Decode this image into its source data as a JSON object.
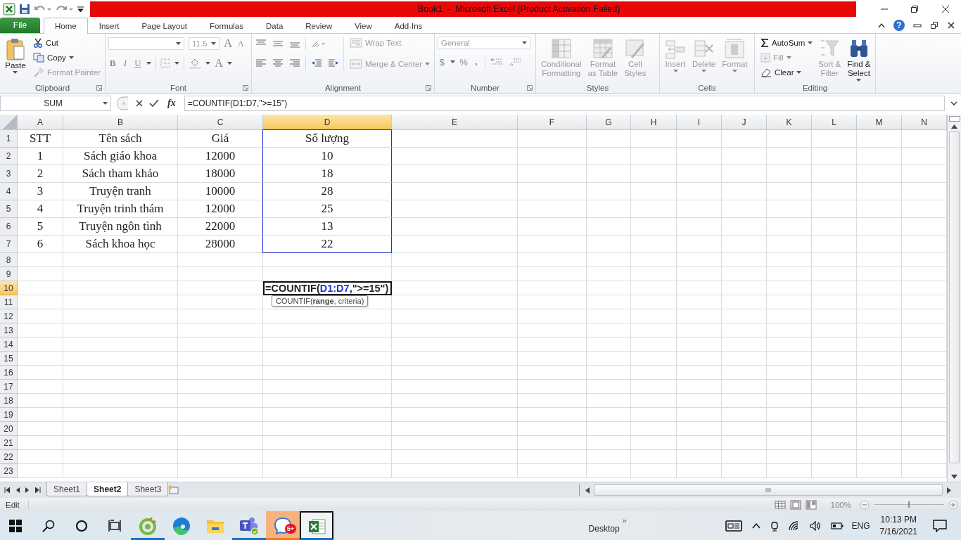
{
  "window": {
    "title": "Book1  -  Microsoft Excel (Product Activation Failed)"
  },
  "tabs": [
    {
      "label": "File",
      "kind": "file",
      "selected": false
    },
    {
      "label": "Home",
      "kind": "tab",
      "selected": true
    },
    {
      "label": "Insert",
      "kind": "tab",
      "selected": false
    },
    {
      "label": "Page Layout",
      "kind": "tab",
      "selected": false
    },
    {
      "label": "Formulas",
      "kind": "tab",
      "selected": false
    },
    {
      "label": "Data",
      "kind": "tab",
      "selected": false
    },
    {
      "label": "Review",
      "kind": "tab",
      "selected": false
    },
    {
      "label": "View",
      "kind": "tab",
      "selected": false
    },
    {
      "label": "Add-Ins",
      "kind": "tab",
      "selected": false
    }
  ],
  "help": "?",
  "ribbon": {
    "clipboard": {
      "title": "Clipboard",
      "paste": {
        "label": "Paste",
        "disabled": false
      },
      "cut": {
        "label": "Cut",
        "disabled": false
      },
      "copy": {
        "label": "Copy",
        "disabled": false
      },
      "format_painter": {
        "label": "Format Painter",
        "disabled": true
      }
    },
    "font": {
      "title": "Font",
      "size": "11.5",
      "grow": "A",
      "shrink": "A",
      "bold": "B",
      "italic": "I",
      "underline": "U",
      "font_color": "A"
    },
    "alignment": {
      "title": "Alignment",
      "wrap_text": {
        "label": "Wrap Text",
        "disabled": true
      },
      "merge_center": {
        "label": "Merge & Center",
        "disabled": true
      }
    },
    "number": {
      "title": "Number",
      "format": "General",
      "currency": "$",
      "percent": "%",
      "comma": ","
    },
    "styles": {
      "title": "Styles",
      "buttons": [
        {
          "label": "Conditional\nFormatting",
          "kind": "conditional",
          "disabled": true
        },
        {
          "label": "Format\nas Table",
          "kind": "table",
          "disabled": true
        },
        {
          "label": "Cell\nStyles",
          "kind": "cell-styles",
          "disabled": true
        }
      ]
    },
    "cells": {
      "title": "Cells",
      "buttons": [
        {
          "label": "Insert",
          "kind": "insert",
          "disabled": true
        },
        {
          "label": "Delete",
          "kind": "delete",
          "disabled": true
        },
        {
          "label": "Format",
          "kind": "format",
          "disabled": true
        }
      ]
    },
    "editing": {
      "title": "Editing",
      "autosum": {
        "label": "AutoSum",
        "disabled": false
      },
      "fill": {
        "label": "Fill",
        "disabled": true
      },
      "clear": {
        "label": "Clear",
        "disabled": false
      },
      "sort_filter": {
        "label": "Sort &\nFilter",
        "disabled": true
      },
      "find_select": {
        "label": "Find &\nSelect",
        "disabled": false
      }
    }
  },
  "formula_bar": {
    "name_box": "SUM",
    "function_label": "fx",
    "formula": "=COUNTIF(D1:D7,\">=15\")"
  },
  "columns": [
    {
      "label": "A",
      "selected": false
    },
    {
      "label": "B",
      "selected": false
    },
    {
      "label": "C",
      "selected": false
    },
    {
      "label": "D",
      "selected": true
    },
    {
      "label": "E",
      "selected": false
    },
    {
      "label": "F",
      "selected": false
    },
    {
      "label": "G",
      "selected": false
    },
    {
      "label": "H",
      "selected": false
    },
    {
      "label": "I",
      "selected": false
    },
    {
      "label": "J",
      "selected": false
    },
    {
      "label": "K",
      "selected": false
    },
    {
      "label": "L",
      "selected": false
    },
    {
      "label": "M",
      "selected": false
    },
    {
      "label": "N",
      "selected": false
    }
  ],
  "rows": [
    {
      "number": "1",
      "selected": false,
      "in_reference": true,
      "cells": [
        "STT",
        "Tên sách",
        "Giá",
        "Số lượng"
      ]
    },
    {
      "number": "2",
      "selected": false,
      "in_reference": true,
      "cells": [
        "1",
        "Sách giáo khoa",
        "12000",
        "10"
      ]
    },
    {
      "number": "3",
      "selected": false,
      "in_reference": true,
      "cells": [
        "2",
        "Sách tham khảo",
        "18000",
        "18"
      ]
    },
    {
      "number": "4",
      "selected": false,
      "in_reference": true,
      "cells": [
        "3",
        "Truyện tranh",
        "10000",
        "28"
      ]
    },
    {
      "number": "5",
      "selected": false,
      "in_reference": true,
      "cells": [
        "4",
        "Truyện trinh thám",
        "12000",
        "25"
      ]
    },
    {
      "number": "6",
      "selected": false,
      "in_reference": true,
      "cells": [
        "5",
        "Truyện ngôn tình",
        "22000",
        "13"
      ]
    },
    {
      "number": "7",
      "selected": false,
      "in_reference": true,
      "cells": [
        "6",
        "Sách khoa học",
        "28000",
        "22"
      ]
    },
    {
      "number": "8",
      "selected": false,
      "in_reference": false
    },
    {
      "number": "9",
      "selected": false,
      "in_reference": false
    },
    {
      "number": "10",
      "selected": true,
      "in_reference": false,
      "editing": {
        "segments": [
          {
            "text": "=COUNTIF(",
            "kind": "text"
          },
          {
            "text": "D1:D7",
            "kind": "reference"
          },
          {
            "text": ",\">=15\")",
            "kind": "text"
          }
        ],
        "tooltip": "COUNTIF(**range**, criteria)"
      }
    },
    {
      "number": "11",
      "selected": false,
      "in_reference": false
    },
    {
      "number": "12",
      "selected": false,
      "in_reference": false
    },
    {
      "number": "13",
      "selected": false,
      "in_reference": false
    },
    {
      "number": "14",
      "selected": false,
      "in_reference": false
    },
    {
      "number": "15",
      "selected": false,
      "in_reference": false
    },
    {
      "number": "16",
      "selected": false,
      "in_reference": false
    },
    {
      "number": "17",
      "selected": false,
      "in_reference": false
    },
    {
      "number": "18",
      "selected": false,
      "in_reference": false
    },
    {
      "number": "19",
      "selected": false,
      "in_reference": false
    },
    {
      "number": "20",
      "selected": false,
      "in_reference": false
    },
    {
      "number": "21",
      "selected": false,
      "in_reference": false
    },
    {
      "number": "22",
      "selected": false,
      "in_reference": false
    },
    {
      "number": "23",
      "selected": false,
      "in_reference": false
    }
  ],
  "sheet_tabs": [
    {
      "label": "Sheet1",
      "selected": false
    },
    {
      "label": "Sheet2",
      "selected": true
    },
    {
      "label": "Sheet3",
      "selected": false
    }
  ],
  "status_bar": {
    "mode": "Edit",
    "zoom": "100%",
    "level": 0.5
  },
  "taskbar": {
    "apps": [
      {
        "kind": "coccoc",
        "running": true,
        "selected": false,
        "flashing": false
      },
      {
        "kind": "edge",
        "running": false,
        "selected": false,
        "flashing": false
      },
      {
        "kind": "explorer",
        "running": false,
        "selected": false,
        "flashing": false
      },
      {
        "kind": "teams",
        "running": true,
        "selected": false,
        "flashing": false
      },
      {
        "kind": "zalo",
        "running": true,
        "selected": false,
        "flashing": true,
        "badge": "5+"
      },
      {
        "kind": "excel",
        "running": true,
        "selected": true,
        "flashing": false
      }
    ],
    "toolbar_label": "Desktop",
    "toolbar_chevron": "»",
    "language": "ENG",
    "time": "10:13 PM",
    "date": "7/16/2021"
  }
}
